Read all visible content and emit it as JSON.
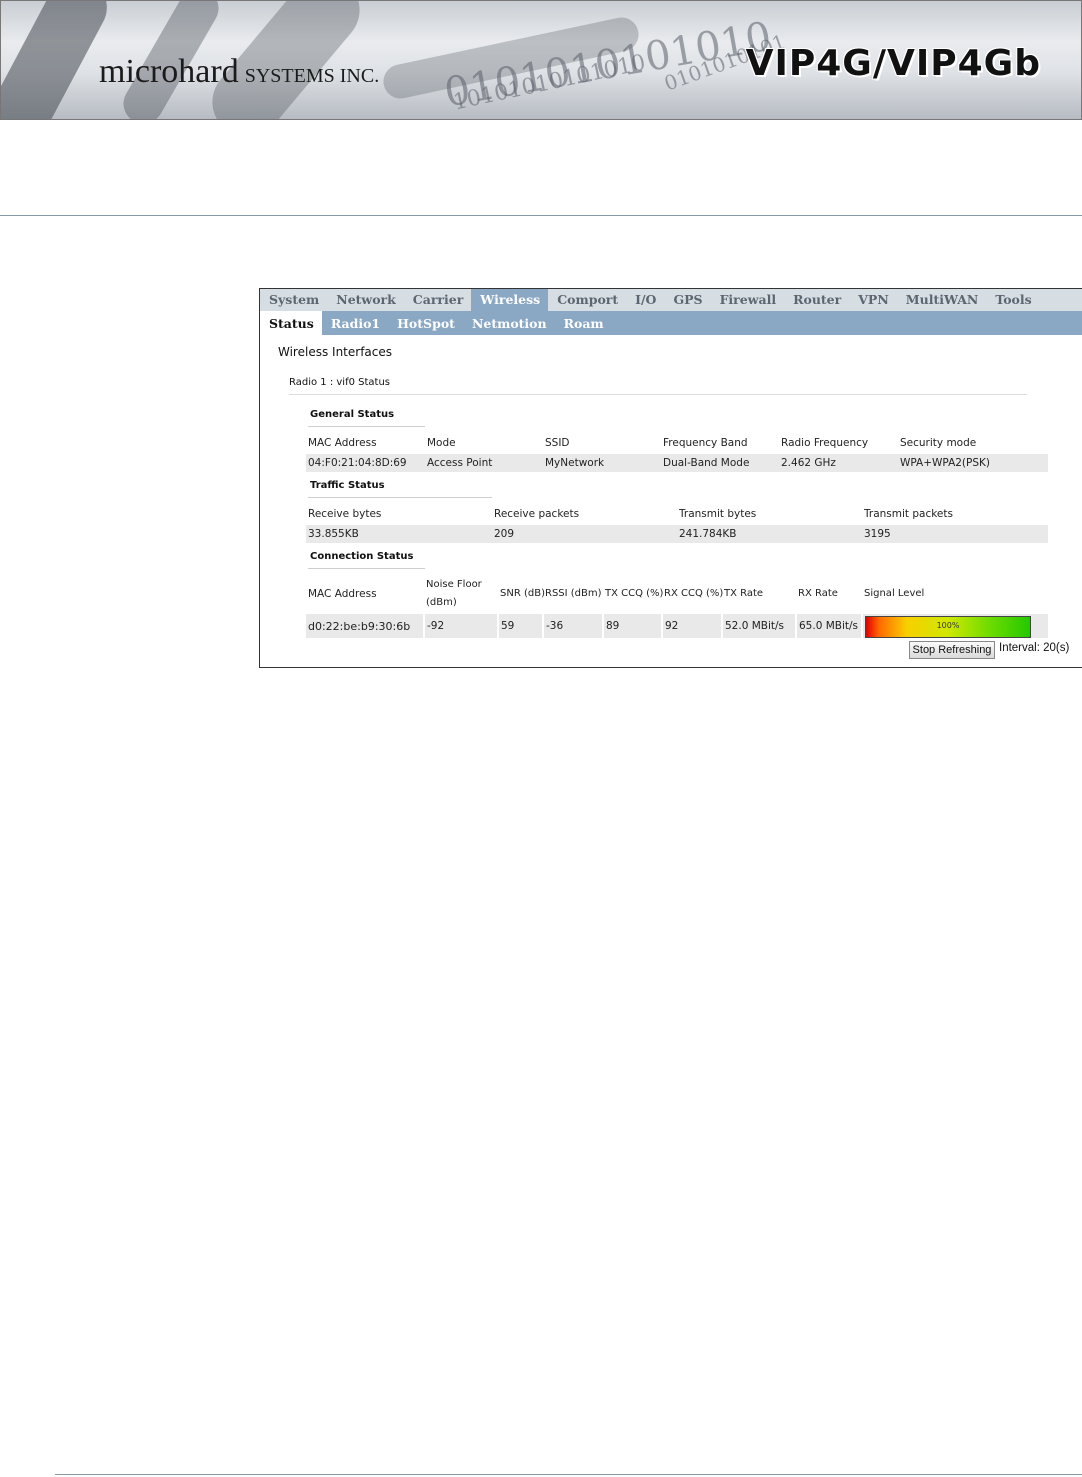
{
  "header": {
    "brand_main": "microhard",
    "brand_sub": "SYSTEMS INC.",
    "product": "VIP4G/VIP4Gb",
    "binary_art": [
      "0101010101010",
      "10101010101010",
      "0101010101"
    ]
  },
  "ui": {
    "top_tabs": [
      "System",
      "Network",
      "Carrier",
      "Wireless",
      "Comport",
      "I/O",
      "GPS",
      "Firewall",
      "Router",
      "VPN",
      "MultiWAN",
      "Tools"
    ],
    "top_tab_active": "Wireless",
    "sub_tabs": [
      "Status",
      "Radio1",
      "HotSpot",
      "Netmotion",
      "Roam"
    ],
    "sub_tab_active": "Status",
    "page_heading": "Wireless Interfaces",
    "radio_heading": "Radio 1 : vif0 Status",
    "general": {
      "title": "General Status",
      "labels": [
        "MAC Address",
        "Mode",
        "SSID",
        "Frequency Band",
        "Radio Frequency",
        "Security mode"
      ],
      "values": [
        "04:F0:21:04:8D:69",
        "Access Point",
        "MyNetwork",
        "Dual-Band Mode",
        "2.462 GHz",
        "WPA+WPA2(PSK)"
      ]
    },
    "traffic": {
      "title": "Traffic Status",
      "labels": [
        "Receive bytes",
        "Receive packets",
        "Transmit bytes",
        "Transmit packets"
      ],
      "values": [
        "33.855KB",
        "209",
        "241.784KB",
        "3195"
      ]
    },
    "connection": {
      "title": "Connection Status",
      "labels": [
        "MAC Address",
        "Noise Floor",
        "(dBm)",
        "SNR (dB)",
        "RSSI (dBm)",
        "TX CCQ (%)",
        "RX CCQ (%)",
        "TX Rate",
        "RX Rate",
        "Signal Level"
      ],
      "values": [
        "d0:22:be:b9:30:6b",
        "-92",
        "59",
        "-36",
        "89",
        "92",
        "52.0 MBit/s",
        "65.0 MBit/s"
      ],
      "signal_percent": 100,
      "signal_text": "100%"
    },
    "stop_button": "Stop Refreshing",
    "interval": "Interval: 20(s)"
  }
}
